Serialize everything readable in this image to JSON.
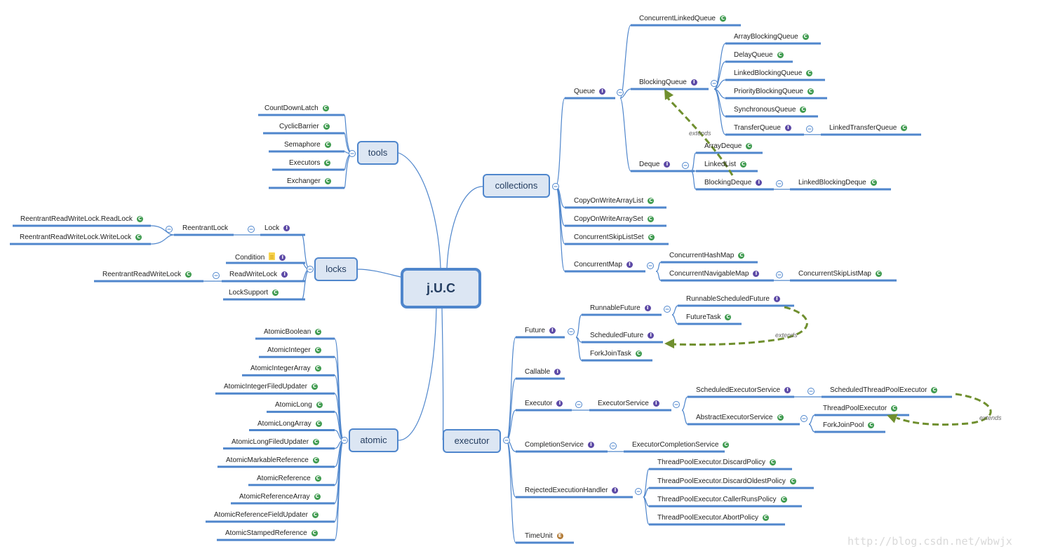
{
  "central": {
    "label": "j.U.C"
  },
  "colors": {
    "line": "#4f86cc",
    "topic_fill": "#dce6f3",
    "extends_arrow": "#6f8f2e",
    "class_badge": "#3f9b4f",
    "interface_badge": "#5d4aa6",
    "enum_badge": "#b27a35"
  },
  "badges": {
    "class": "C",
    "interface": "I",
    "enum": "E"
  },
  "topics": {
    "tools": "tools",
    "locks": "locks",
    "atomic": "atomic",
    "collections": "collections",
    "executor": "executor"
  },
  "tools": [
    {
      "label": "CountDownLatch",
      "kind": "class"
    },
    {
      "label": "CyclicBarrier",
      "kind": "class"
    },
    {
      "label": "Semaphore",
      "kind": "class"
    },
    {
      "label": "Executors",
      "kind": "class"
    },
    {
      "label": "Exchanger",
      "kind": "class"
    }
  ],
  "locks": {
    "lock": {
      "label": "Lock",
      "kind": "interface"
    },
    "reentrantlock": {
      "label": "ReentrantLock"
    },
    "readlock": {
      "label": "ReentrantReadWriteLock.ReadLock",
      "kind": "class"
    },
    "writelock": {
      "label": "ReentrantReadWriteLock.WriteLock",
      "kind": "class"
    },
    "condition": {
      "label": "Condition",
      "kind": "interface",
      "has_note": true
    },
    "readwritelock": {
      "label": "ReadWriteLock",
      "kind": "interface"
    },
    "rrwl": {
      "label": "ReentrantReadWriteLock",
      "kind": "class"
    },
    "locksupport": {
      "label": "LockSupport",
      "kind": "class"
    }
  },
  "atomic": [
    {
      "label": "AtomicBoolean",
      "kind": "class"
    },
    {
      "label": "AtomicInteger",
      "kind": "class"
    },
    {
      "label": "AtomicIntegerArray",
      "kind": "class"
    },
    {
      "label": "AtomicIntegerFiledUpdater",
      "kind": "class"
    },
    {
      "label": "AtomicLong",
      "kind": "class"
    },
    {
      "label": "AtomicLongArray",
      "kind": "class"
    },
    {
      "label": "AtomicLongFiledUpdater",
      "kind": "class"
    },
    {
      "label": "AtomicMarkableReference",
      "kind": "class"
    },
    {
      "label": "AtomicReference",
      "kind": "class"
    },
    {
      "label": "AtomicReferenceArray",
      "kind": "class"
    },
    {
      "label": "AtomicReferenceFieldUpdater",
      "kind": "class"
    },
    {
      "label": "AtomicStampedReference",
      "kind": "class"
    }
  ],
  "collections": {
    "queue": {
      "label": "Queue",
      "kind": "interface"
    },
    "clq": {
      "label": "ConcurrentLinkedQueue",
      "kind": "class"
    },
    "blockingqueue": {
      "label": "BlockingQueue",
      "kind": "interface"
    },
    "abq": {
      "label": "ArrayBlockingQueue",
      "kind": "class"
    },
    "delayq": {
      "label": "DelayQueue",
      "kind": "class"
    },
    "lbq": {
      "label": "LinkedBlockingQueue",
      "kind": "class"
    },
    "pbq": {
      "label": "PriorityBlockingQueue",
      "kind": "class"
    },
    "sq": {
      "label": "SynchronousQueue",
      "kind": "class"
    },
    "tq": {
      "label": "TransferQueue",
      "kind": "interface"
    },
    "ltq": {
      "label": "LinkedTransferQueue",
      "kind": "class"
    },
    "deque": {
      "label": "Deque",
      "kind": "interface"
    },
    "arraydeque": {
      "label": "ArrayDeque",
      "kind": "class"
    },
    "linkedlist": {
      "label": "LinkedList",
      "kind": "class"
    },
    "blockingdeque": {
      "label": "BlockingDeque",
      "kind": "interface"
    },
    "lbd": {
      "label": "LinkedBlockingDeque",
      "kind": "class"
    },
    "cowal": {
      "label": "CopyOnWriteArrayList",
      "kind": "class"
    },
    "cowas": {
      "label": "CopyOnWriteArraySet",
      "kind": "class"
    },
    "csls": {
      "label": "ConcurrentSkipListSet",
      "kind": "class"
    },
    "cmap": {
      "label": "ConcurrentMap",
      "kind": "interface"
    },
    "chm": {
      "label": "ConcurrentHashMap",
      "kind": "class"
    },
    "cnm": {
      "label": "ConcurrentNavigableMap",
      "kind": "interface"
    },
    "cslm": {
      "label": "ConcurrentSkipListMap",
      "kind": "class"
    }
  },
  "executor": {
    "future": {
      "label": "Future",
      "kind": "interface"
    },
    "runnablefuture": {
      "label": "RunnableFuture",
      "kind": "interface"
    },
    "rsf": {
      "label": "RunnableScheduledFuture",
      "kind": "interface"
    },
    "futuretask": {
      "label": "FutureTask",
      "kind": "class"
    },
    "scheduledfuture": {
      "label": "ScheduledFuture",
      "kind": "interface"
    },
    "forkjointask": {
      "label": "ForkJoinTask",
      "kind": "class"
    },
    "callable": {
      "label": "Callable",
      "kind": "interface"
    },
    "executor": {
      "label": "Executor",
      "kind": "interface"
    },
    "executorservice": {
      "label": "ExecutorService",
      "kind": "interface"
    },
    "ses": {
      "label": "ScheduledExecutorService",
      "kind": "interface"
    },
    "stpe": {
      "label": "ScheduledThreadPoolExecutor",
      "kind": "class"
    },
    "aes": {
      "label": "AbstractExecutorService",
      "kind": "class"
    },
    "tpe": {
      "label": "ThreadPoolExecutor",
      "kind": "class"
    },
    "fjp": {
      "label": "ForkJoinPool",
      "kind": "class"
    },
    "completionservice": {
      "label": "CompletionService",
      "kind": "interface"
    },
    "ecs": {
      "label": "ExecutorCompletionService",
      "kind": "class"
    },
    "reh": {
      "label": "RejectedExecutionHandler",
      "kind": "interface"
    },
    "discard": {
      "label": "ThreadPoolExecutor.DiscardPolicy",
      "kind": "class"
    },
    "discardoldest": {
      "label": "ThreadPoolExecutor.DiscardOldestPolicy",
      "kind": "class"
    },
    "callerruns": {
      "label": "ThreadPoolExecutor.CallerRunsPolicy",
      "kind": "class"
    },
    "abort": {
      "label": "ThreadPoolExecutor.AbortPolicy",
      "kind": "class"
    },
    "timeunit": {
      "label": "TimeUnit",
      "kind": "enum"
    }
  },
  "relations": {
    "extends_label": "extends"
  },
  "watermark": "http://blog.csdn.net/wbwjx"
}
